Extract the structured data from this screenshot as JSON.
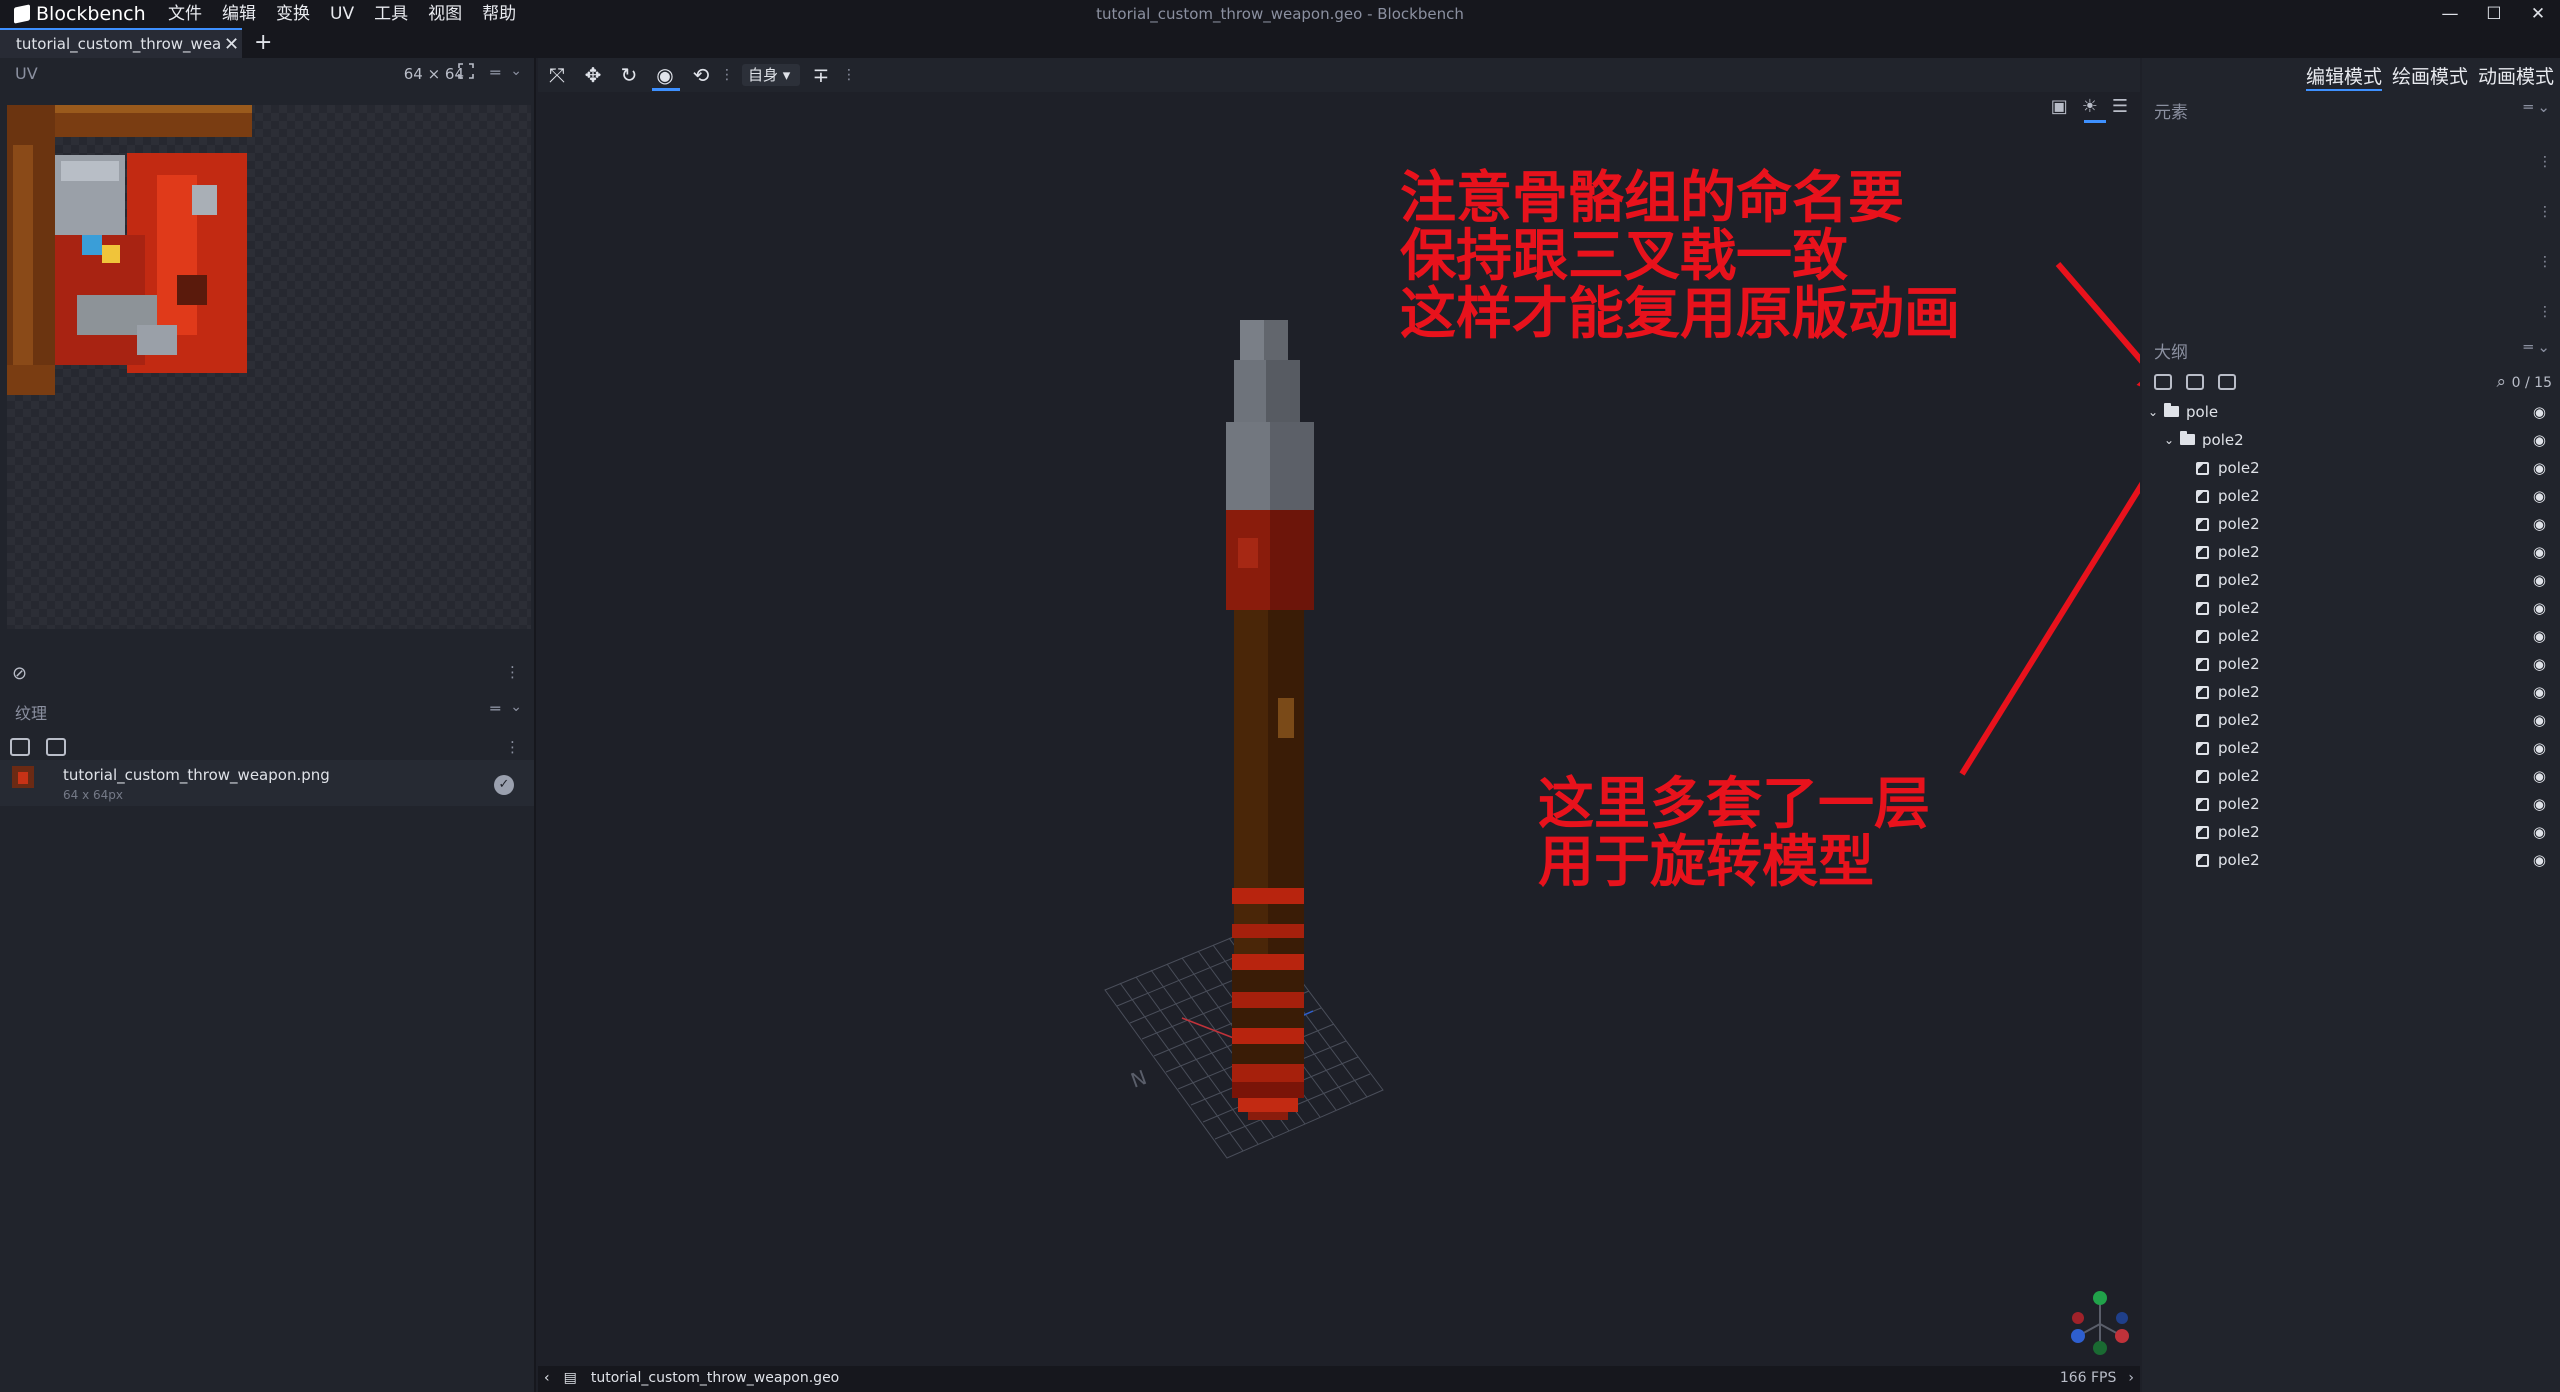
{
  "app": {
    "name": "Blockbench",
    "window_title": "tutorial_custom_throw_weapon.geo - Blockbench",
    "menu": [
      "文件",
      "编辑",
      "变换",
      "UV",
      "工具",
      "视图",
      "帮助"
    ],
    "window_controls": [
      "—",
      "☐",
      "✕"
    ]
  },
  "tabs": {
    "active": "tutorial_custom_throw_weapc",
    "close": "✕",
    "add": "+"
  },
  "uv_panel": {
    "title": "UV",
    "size": "64 × 64",
    "menu": "═",
    "chevron": "⌄"
  },
  "texture_panel": {
    "title": "纹理",
    "menu": "═",
    "chevron": "⌄",
    "texture": {
      "name": "tutorial_custom_throw_weapon.png",
      "dimensions": "64 x 64px",
      "check": "✓"
    }
  },
  "viewport": {
    "space_select": "自身",
    "annotation_top": [
      "注意骨骼组的命名要",
      "保持跟三叉戟一致",
      "这样才能复用原版动画"
    ],
    "annotation_bottom": [
      "这里多套了一层",
      "用于旋转模型"
    ],
    "annotation_color": "#e8121c"
  },
  "statusbar": {
    "file": "tutorial_custom_throw_weapon.geo",
    "fps": "166 FPS"
  },
  "modes": [
    "编辑模式",
    "绘画模式",
    "动画模式"
  ],
  "element_panel": {
    "title": "元素",
    "menu": "═",
    "chevron": "⌄"
  },
  "outliner": {
    "title": "大纲",
    "menu": "═",
    "chevron": "⌄",
    "count": "0 / 15",
    "items": [
      {
        "name": "pole",
        "type": "group",
        "depth": 0
      },
      {
        "name": "pole2",
        "type": "group",
        "depth": 1
      },
      {
        "name": "pole2",
        "type": "cube",
        "depth": 2
      },
      {
        "name": "pole2",
        "type": "cube",
        "depth": 2
      },
      {
        "name": "pole2",
        "type": "cube",
        "depth": 2
      },
      {
        "name": "pole2",
        "type": "cube",
        "depth": 2
      },
      {
        "name": "pole2",
        "type": "cube",
        "depth": 2
      },
      {
        "name": "pole2",
        "type": "cube",
        "depth": 2
      },
      {
        "name": "pole2",
        "type": "cube",
        "depth": 2
      },
      {
        "name": "pole2",
        "type": "cube",
        "depth": 2
      },
      {
        "name": "pole2",
        "type": "cube",
        "depth": 2
      },
      {
        "name": "pole2",
        "type": "cube",
        "depth": 2
      },
      {
        "name": "pole2",
        "type": "cube",
        "depth": 2
      },
      {
        "name": "pole2",
        "type": "cube",
        "depth": 2
      },
      {
        "name": "pole2",
        "type": "cube",
        "depth": 2
      },
      {
        "name": "pole2",
        "type": "cube",
        "depth": 2
      },
      {
        "name": "pole2",
        "type": "cube",
        "depth": 2
      }
    ]
  },
  "colors": {
    "accent": "#3e90ff",
    "background": "#1e2028",
    "panel": "#21242c"
  }
}
